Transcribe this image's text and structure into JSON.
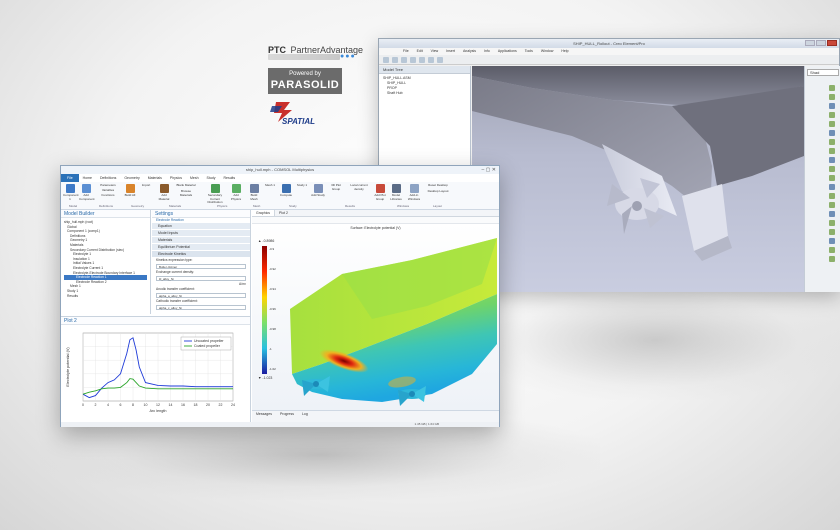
{
  "logos": {
    "ptc": "PTC",
    "partner": "PartnerAdvantage",
    "powered_by": "Powered by",
    "parasolid": "PARASOLID",
    "spatial": "SPATIAL"
  },
  "back_window": {
    "title": "SHIP_HULL_Rollout - Creo Element/Pro",
    "menu": [
      "File",
      "Edit",
      "View",
      "Insert",
      "Analysis",
      "Info",
      "Applications",
      "Tools",
      "Window",
      "Help"
    ],
    "tree_header": "Model Tree",
    "tree_items": [
      "SHIP_HULL.ASM",
      "SHIP_HULL",
      "PROP",
      "Shaft Hub"
    ],
    "view_select": "Shad",
    "colors": {
      "hull": "#8f90a0",
      "propeller": "#d0d3e2",
      "background": "#b8bcd0"
    }
  },
  "front_window": {
    "title": "ship_hull.mph - COMSOL Multiphysics",
    "tabs": [
      "File",
      "Home",
      "Definitions",
      "Geometry",
      "Materials",
      "Physics",
      "Mesh",
      "Study",
      "Results"
    ],
    "ribbon": {
      "buttons": [
        "Component 1",
        "Add Component",
        "Parameters",
        "Variables",
        "Functions",
        "Build All",
        "Import",
        "Add Material",
        "Blank Material",
        "Browse Materials",
        "Secondary Current Distribution",
        "Add Physics",
        "Build Mesh",
        "Mesh 1",
        "Compute",
        "Study 1",
        "Add Study",
        "3D Plot Group",
        "Local current density",
        "Add Plot Group",
        "Model Libraries",
        "Add-in Windows",
        "Reset Desktop",
        "Desktop Layout"
      ],
      "groups": [
        "Model",
        "Definitions",
        "Geometry",
        "Materials",
        "Physics",
        "Mesh",
        "Study",
        "Results",
        "Windows",
        "Layout"
      ]
    },
    "model_builder": {
      "title": "Model Builder",
      "tree": [
        "ship_hull.mph (root)",
        "Global",
        "Component 1 (comp1)",
        "Definitions",
        "Geometry 1",
        "Materials",
        "Secondary Current Distribution (siec)",
        "Electrolyte 1",
        "Insulation 1",
        "Initial Values 1",
        "Electrolyte Current 1",
        "Electrolyte-Electrode Boundary Interface 1",
        "Electrode Reaction 1",
        "Electrode Reaction 2",
        "Mesh 1",
        "Study 1",
        "Results"
      ],
      "highlighted_index": 12
    },
    "settings": {
      "title": "Settings",
      "subtitle": "Electrode Reaction",
      "sections": [
        "Equation",
        "Model Inputs",
        "Materials",
        "Equilibrium Potential",
        "Electrode Kinetics"
      ],
      "kinetics_label": "Kinetics expression type:",
      "kinetics_value": "Butler-Volmer",
      "exchange_label": "Exchange current density:",
      "exchange_value": "i0_alloy_Ni",
      "anodic_label": "Anodic transfer coefficient:",
      "anodic_value": "alpha_a_alloy_Ni",
      "cathodic_label": "Cathodic transfer coefficient:",
      "cathodic_value": "alpha_c_alloy_Ni",
      "unit": "A/m²"
    },
    "plot2": {
      "title": "Plot 2",
      "ylabel": "Electrolyte potential (V)",
      "xlabel": "Arc length",
      "legend": [
        "Uncoated propeller",
        "Coated propeller"
      ],
      "colors": [
        "#1f3bd8",
        "#2aa52a"
      ]
    },
    "graphics": {
      "tabs": [
        "Graphics",
        "Plot 2"
      ],
      "caption": "Surface: Electrolyte potential (V)",
      "colorbar_ticks": [
        "-0.9",
        "-0.92",
        "-0.94",
        "-0.96",
        "-0.98",
        "-1",
        "-1.02"
      ],
      "colorbar_max_label": "▲ -0.8986",
      "colorbar_min_label": "▼ -1.023"
    },
    "messages_tabs": [
      "Messages",
      "Progress",
      "Log"
    ],
    "status": "1.45 GB | 1.64 GB"
  },
  "chart_data": {
    "type": "line",
    "title": "",
    "xlabel": "Arc length",
    "ylabel": "Electrolyte potential (V)",
    "x": [
      0,
      1,
      2,
      3,
      4,
      5,
      6,
      7,
      7.5,
      8,
      8.5,
      9,
      10,
      12,
      14,
      16,
      18,
      20,
      22,
      24
    ],
    "series": [
      {
        "name": "Uncoated propeller",
        "values": [
          -0.95,
          -1.0,
          -0.97,
          -0.86,
          -0.78,
          -0.74,
          -0.65,
          -0.35,
          -0.15,
          -0.12,
          -0.3,
          -0.55,
          -0.78,
          -0.82,
          -0.83,
          -0.83,
          -0.84,
          -0.84,
          -0.84,
          -0.84
        ]
      },
      {
        "name": "Coated propeller",
        "values": [
          -0.95,
          -0.92,
          -0.9,
          -0.87,
          -0.86,
          -0.86,
          -0.85,
          -0.78,
          -0.72,
          -0.73,
          -0.78,
          -0.83,
          -0.86,
          -0.87,
          -0.87,
          -0.87,
          -0.87,
          -0.87,
          -0.87,
          -0.87
        ]
      }
    ],
    "xlim": [
      0,
      24
    ],
    "ylim": [
      -1.05,
      -0.05
    ],
    "xticks": [
      "0",
      "2",
      "4",
      "6",
      "8",
      "10",
      "12",
      "14",
      "16",
      "18",
      "20",
      "22",
      "24"
    ],
    "legend_position": "top-right",
    "grid": true
  }
}
